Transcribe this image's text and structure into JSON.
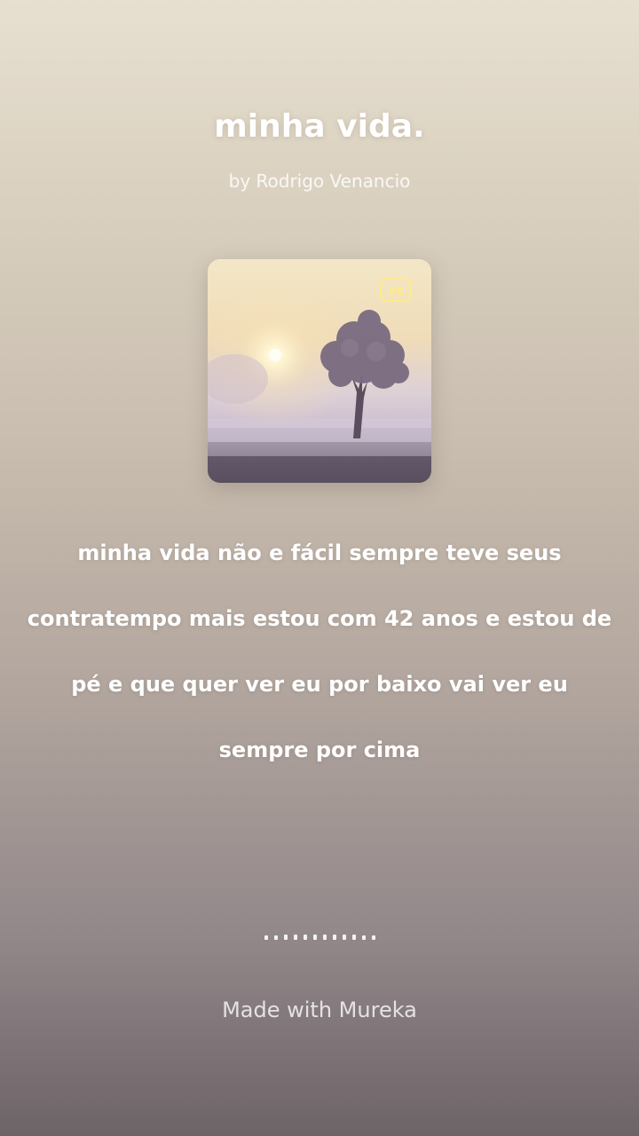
{
  "song": {
    "title": "minha vida.",
    "artist": "by Rodrigo Venancio"
  },
  "cover": {
    "badge": "V8"
  },
  "lyrics": [
    "minha vida não e fácil sempre teve seus",
    "contratempo mais estou com 42 anos e estou de",
    "pé e que quer ver eu por baixo vai ver eu",
    "sempre por cima"
  ],
  "footer": {
    "text": "Made with Mureka"
  },
  "colors": {
    "background_top": "#e7dfd0",
    "background_bottom": "#6d6468",
    "text": "#ffffff",
    "badge": "#ffec82"
  },
  "icons": {
    "progress": "audio-waveform-dots"
  }
}
